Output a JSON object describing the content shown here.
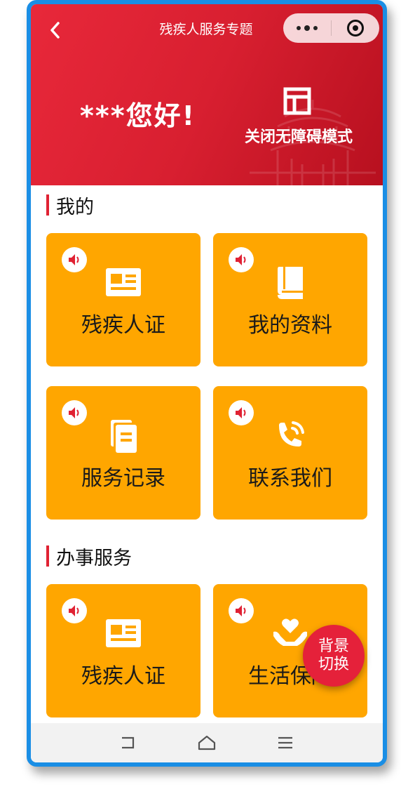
{
  "header": {
    "title": "残疾人服务专题",
    "back_icon": "chevron-left-icon",
    "menu_icon": "more-dots-icon",
    "close_icon": "target-circle-icon"
  },
  "hero": {
    "greeting": "***您好!",
    "accessibility_toggle": {
      "icon": "layout-panel-icon",
      "label": "关闭无障碍模式"
    },
    "background_color": "#d81f30"
  },
  "sections": [
    {
      "title": "我的",
      "cards": [
        {
          "label": "残疾人证",
          "icon": "id-card-icon"
        },
        {
          "label": "我的资料",
          "icon": "book-icon"
        },
        {
          "label": "服务记录",
          "icon": "documents-icon"
        },
        {
          "label": "联系我们",
          "icon": "phone-call-icon"
        }
      ]
    },
    {
      "title": "办事服务",
      "cards": [
        {
          "label": "残疾人证",
          "icon": "id-card-icon"
        },
        {
          "label": "生活保障",
          "icon": "hands-heart-icon"
        }
      ]
    }
  ],
  "card_color": "#ffa600",
  "accent_color": "#e02233",
  "speaker_icon": "speaker-icon",
  "fab": {
    "line1": "背景",
    "line2": "切换"
  },
  "navbar": {
    "back_icon": "nav-back-icon",
    "home_icon": "nav-home-icon",
    "menu_icon": "nav-menu-icon"
  }
}
